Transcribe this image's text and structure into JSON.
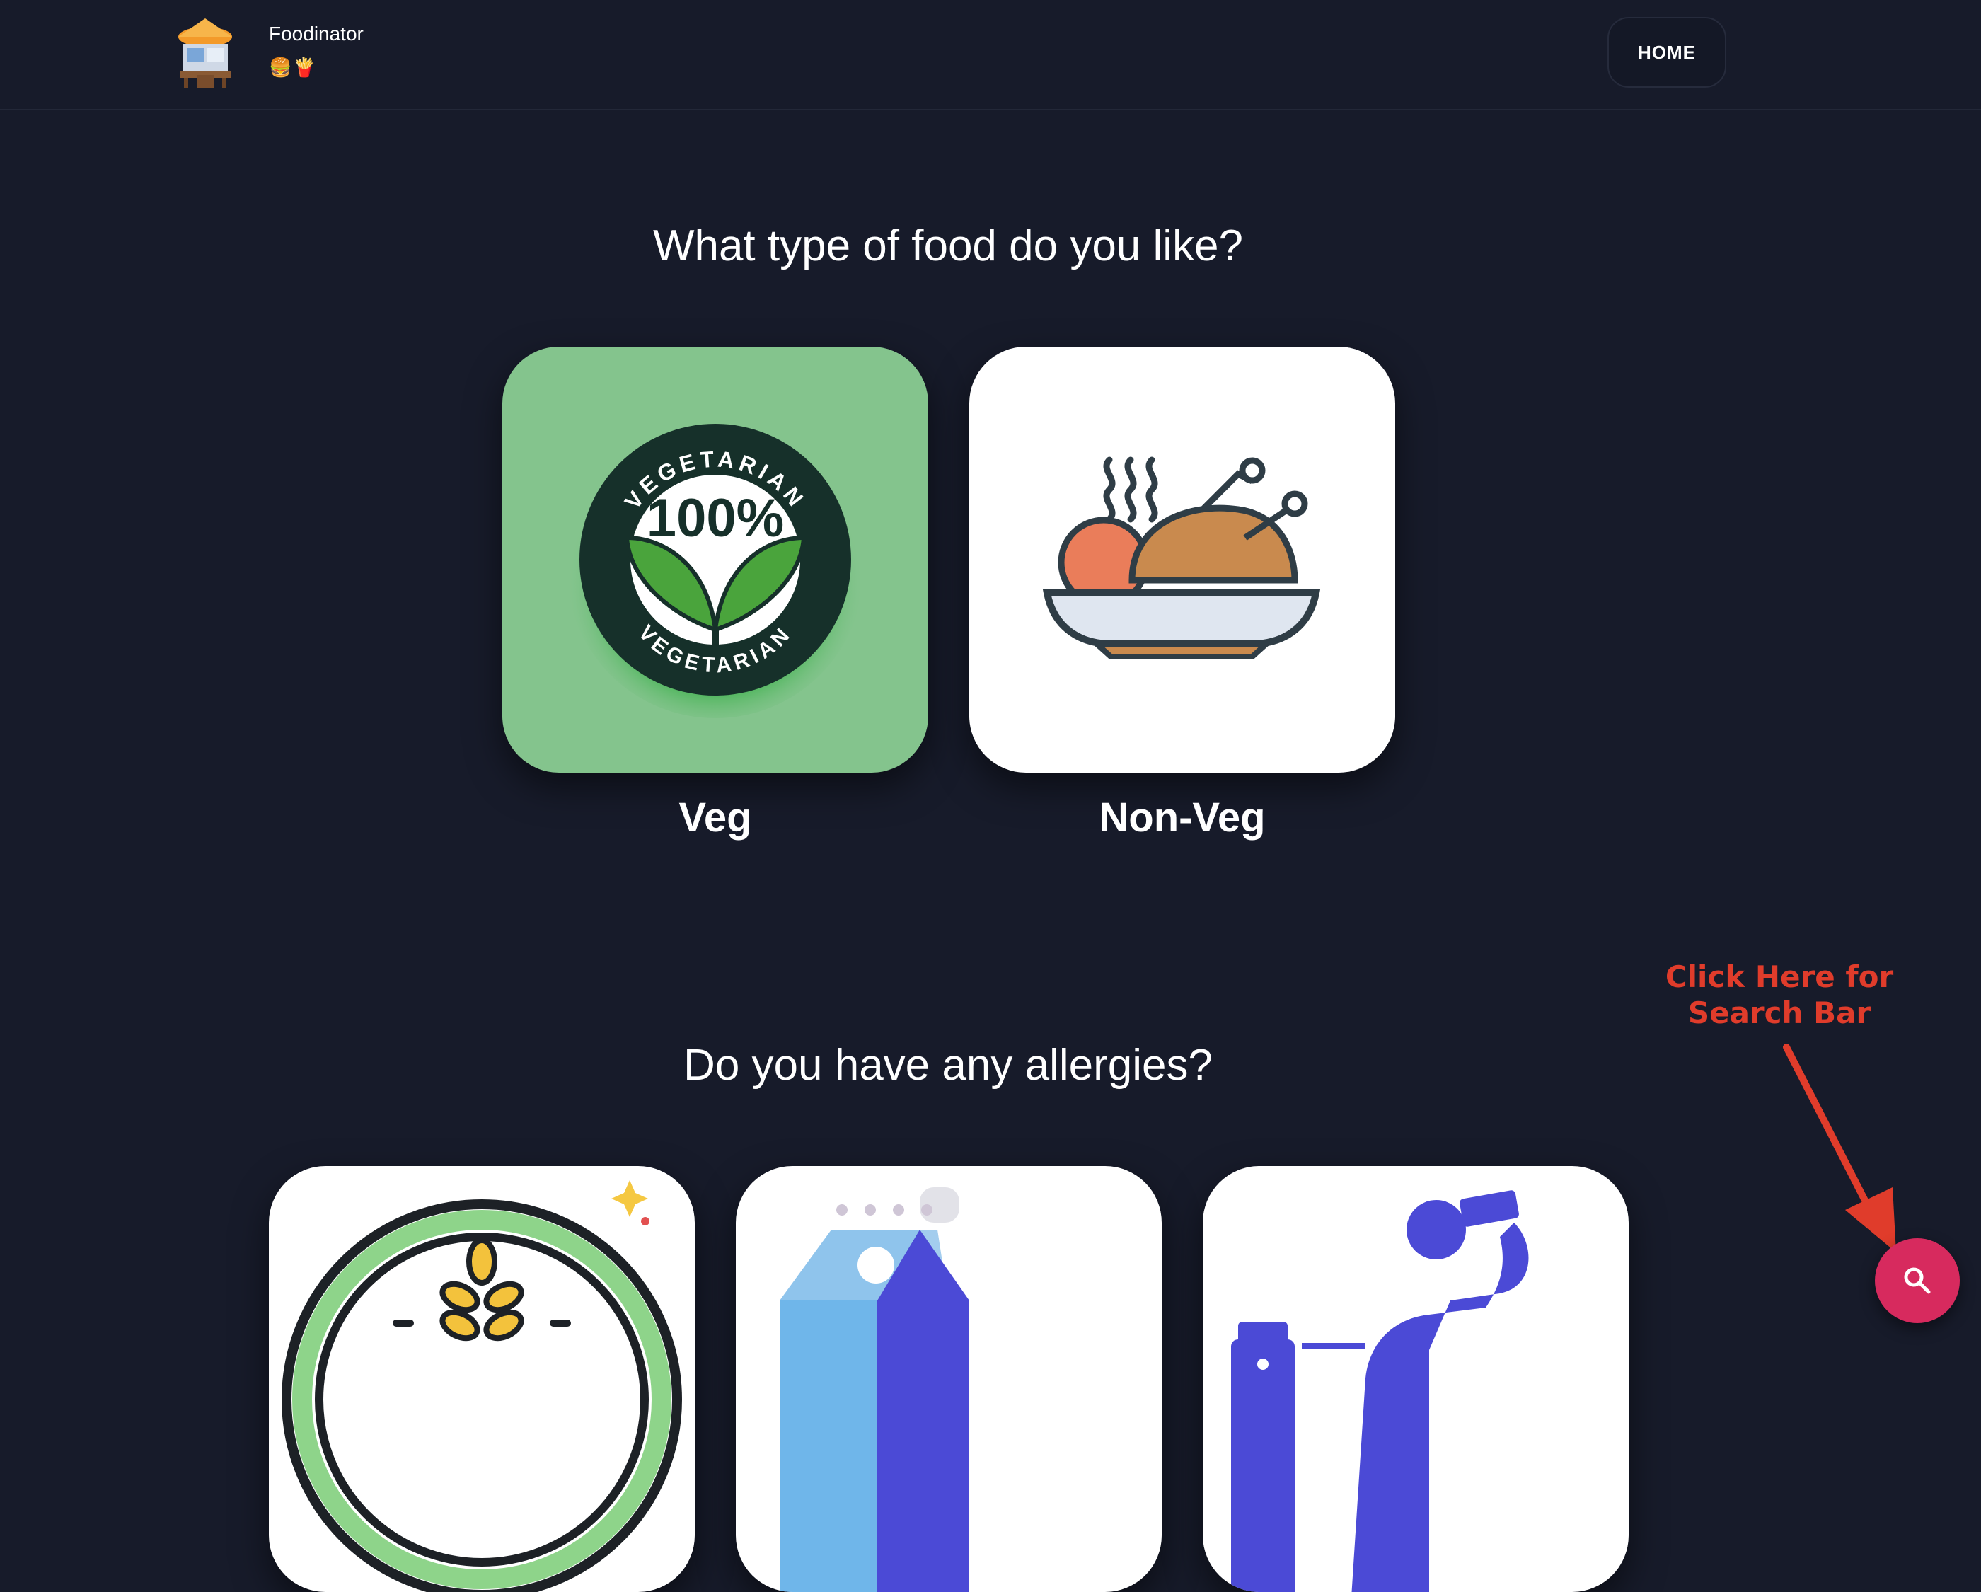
{
  "header": {
    "brand_name": "Foodinator",
    "brand_emoji": "🍔🍟",
    "home_label": "HOME"
  },
  "food_type": {
    "title": "What type of food do you like?",
    "options": [
      {
        "label": "Veg",
        "icon": "vegetarian-badge-icon",
        "bg": "#84c48d"
      },
      {
        "label": "Non-Veg",
        "icon": "roast-chicken-icon",
        "bg": "#ffffff"
      }
    ]
  },
  "allergies": {
    "title": "Do you have any allergies?",
    "options": [
      {
        "icon": "wheat-gluten-icon"
      },
      {
        "icon": "milk-carton-icon"
      },
      {
        "icon": "person-drinking-icon"
      }
    ]
  },
  "search_hint": {
    "line1": "Click Here for",
    "line2": "Search Bar"
  },
  "colors": {
    "background": "#171b2a",
    "accent": "#d72a5e",
    "hint": "#e03c2b"
  }
}
